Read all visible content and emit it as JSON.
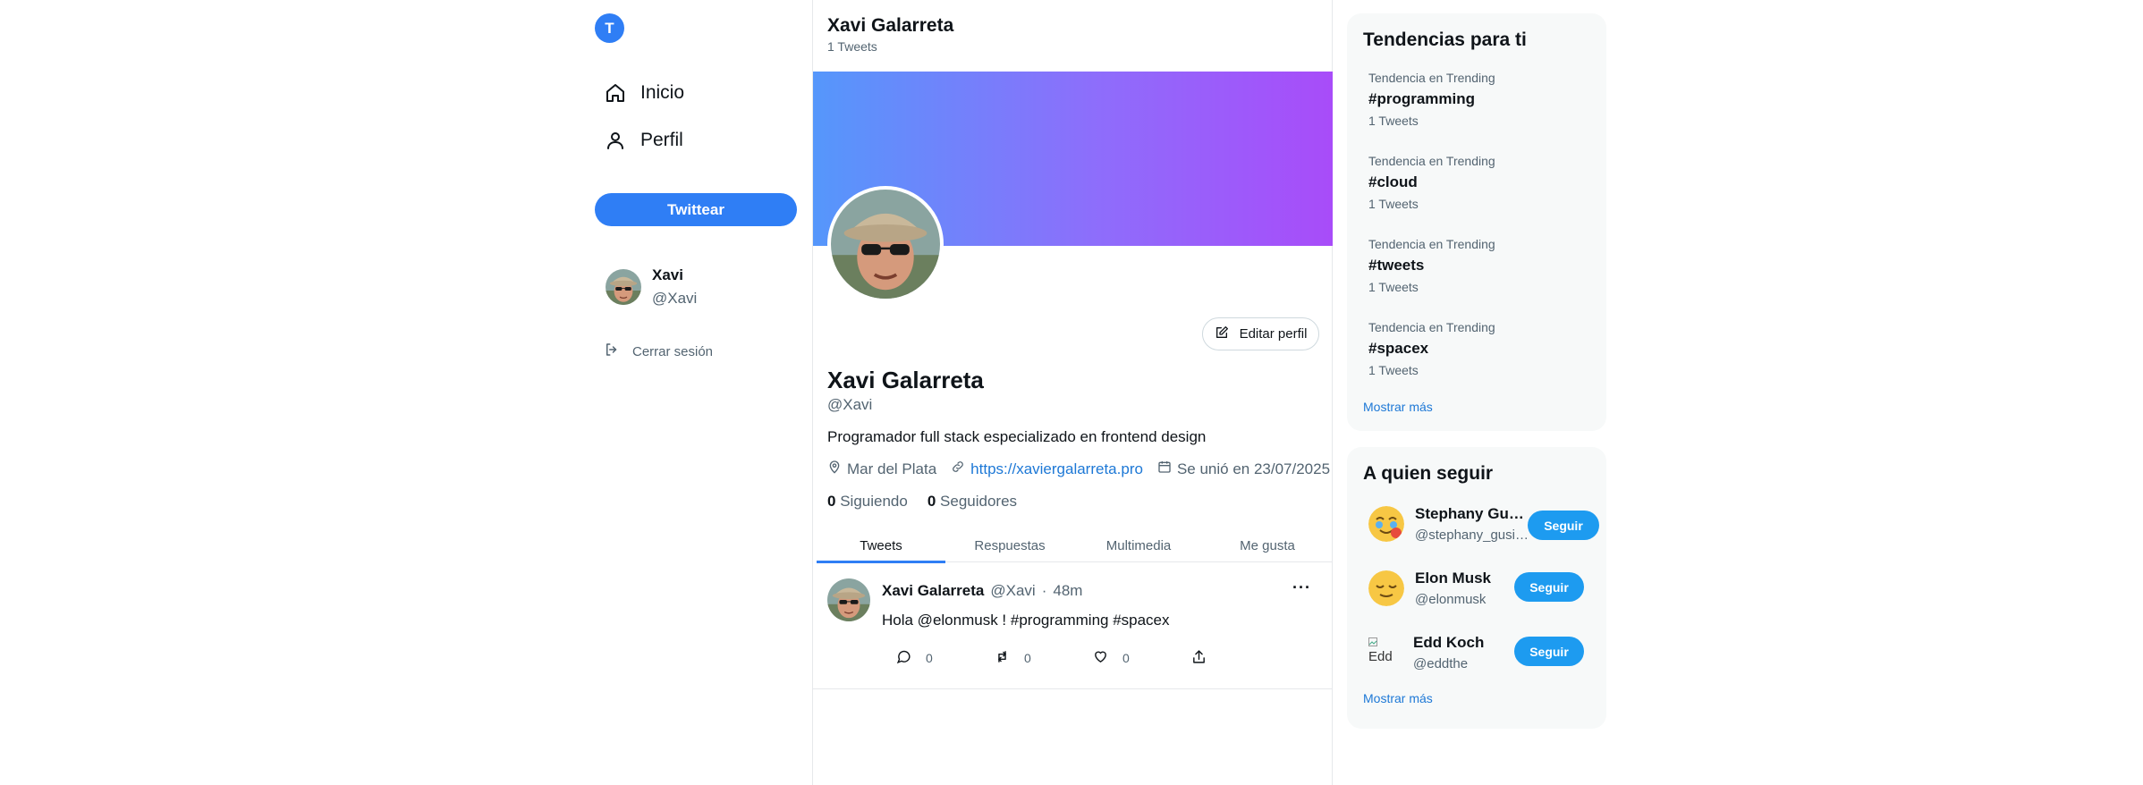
{
  "sidebar": {
    "logo_letter": "T",
    "nav": [
      {
        "label": "Inicio",
        "icon": "home-icon"
      },
      {
        "label": "Perfil",
        "icon": "user-icon"
      }
    ],
    "tweet_button": "Twittear",
    "user": {
      "name": "Xavi",
      "handle": "@Xavi"
    },
    "logout": "Cerrar sesión"
  },
  "header": {
    "name": "Xavi Galarreta",
    "tweet_count": "1 Tweets"
  },
  "profile": {
    "edit_button": "Editar perfil",
    "name": "Xavi Galarreta",
    "handle": "@Xavi",
    "bio": "Programador full stack especializado en frontend design",
    "location": "Mar del Plata",
    "website": "https://xaviergalarreta.pro",
    "joined": "Se unió en 23/07/2025",
    "following_count": "0",
    "following_label": "Siguiendo",
    "followers_count": "0",
    "followers_label": "Seguidores",
    "banner_colors": [
      "#5597fb",
      "#a84cf9"
    ]
  },
  "tabs": [
    "Tweets",
    "Respuestas",
    "Multimedia",
    "Me gusta"
  ],
  "active_tab": "Tweets",
  "tweet": {
    "name": "Xavi Galarreta",
    "handle": "@Xavi",
    "separator": "·",
    "time": "48m",
    "more": "···",
    "text": "Hola @elonmusk !  #programming #spacex",
    "reply_count": "0",
    "retweet_count": "0",
    "like_count": "0"
  },
  "trends": {
    "title": "Tendencias para ti",
    "items": [
      {
        "category": "Tendencia en Trending",
        "tag": "#programming",
        "count": "1 Tweets"
      },
      {
        "category": "Tendencia en Trending",
        "tag": "#cloud",
        "count": "1 Tweets"
      },
      {
        "category": "Tendencia en Trending",
        "tag": "#tweets",
        "count": "1 Tweets"
      },
      {
        "category": "Tendencia en Trending",
        "tag": "#spacex",
        "count": "1 Tweets"
      }
    ],
    "show_more": "Mostrar más"
  },
  "who_to_follow": {
    "title": "A quien seguir",
    "items": [
      {
        "name": "Stephany Gus…",
        "handle": "@stephany_gusi…",
        "button": "Seguir"
      },
      {
        "name": "Elon Musk",
        "handle": "@elonmusk",
        "button": "Seguir"
      },
      {
        "name": "Edd Koch",
        "handle": "@eddthe",
        "button": "Seguir",
        "broken_alt": "Edd"
      }
    ],
    "show_more": "Mostrar más"
  },
  "colors": {
    "accent": "#2f7ef5",
    "follow_button": "#1d9bf0",
    "link": "#1d78d6"
  }
}
